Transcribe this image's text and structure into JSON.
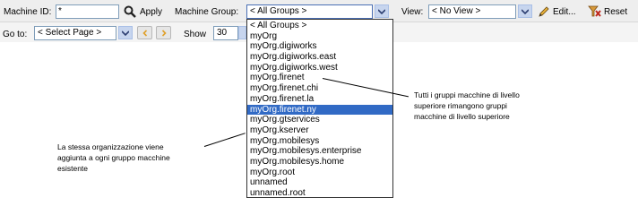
{
  "toolbar": {
    "machine_id_label": "Machine ID:",
    "machine_id_value": "*",
    "apply_label": "Apply",
    "machine_group_label": "Machine Group:",
    "machine_group_value": "< All Groups >",
    "view_label": "View:",
    "view_value": "< No View >",
    "edit_label": "Edit...",
    "reset_label": "Reset"
  },
  "toolbar2": {
    "goto_label": "Go to:",
    "goto_value": "< Select Page >",
    "show_label": "Show",
    "show_value": "30"
  },
  "dropdown": {
    "items": [
      "< All Groups >",
      "myOrg",
      "myOrg.digiworks",
      "myOrg.digiworks.east",
      "myOrg.digiworks.west",
      "myOrg.firenet",
      "myOrg.firenet.chi",
      "myOrg.firenet.la",
      "myOrg.firenet.ny",
      "myOrg.gtservices",
      "myOrg.kserver",
      "myOrg.mobilesys",
      "myOrg.mobilesys.enterprise",
      "myOrg.mobilesys.home",
      "myOrg.root",
      "unnamed",
      "unnamed.root"
    ],
    "selected_index": 8
  },
  "annotations": {
    "right": [
      "Tutti i gruppi macchine di livello",
      "superiore rimangono gruppi",
      "macchine di livello superiore"
    ],
    "left": [
      "La stessa organizzazione viene",
      "aggiunta a ogni gruppo macchine",
      "esistente"
    ]
  },
  "colors": {
    "selection": "#316ac5",
    "toolbar_bg": "#eeeeee",
    "input_border": "#7f9db9"
  }
}
